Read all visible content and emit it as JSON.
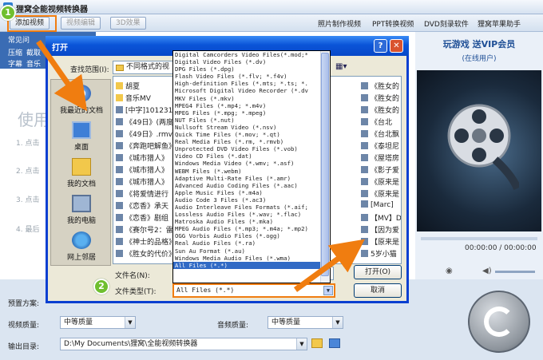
{
  "app": {
    "title": "狸窝全能视频转换器",
    "toolbar": {
      "add_video": "添加视频",
      "video_edit": "视频编辑",
      "effect_3d": "3D效果",
      "links": [
        "照片制作视频",
        "PPT转换视频",
        "DVD刻录软件",
        "狸窝苹果助手"
      ]
    },
    "left_tabs": [
      "常见问",
      "压缩",
      "截取",
      "字幕",
      "音乐"
    ],
    "guide": {
      "heading": "使用",
      "steps": [
        "1. 点击",
        "2. 点击",
        "3. 点击",
        "4. 最后"
      ]
    },
    "promo": {
      "title": "玩游戏 送VIP会员",
      "subtitle": "(在线用户)"
    },
    "player": {
      "time": "00:00:00 / 00:00:00"
    },
    "settings": {
      "preset_label": "预置方案:",
      "video_quality_label": "视频质量:",
      "video_quality_value": "中等质量",
      "audio_quality_label": "音频质量:",
      "audio_quality_value": "中等质量",
      "output_label": "输出目录:",
      "output_value": "D:\\My Documents\\狸窝\\全能视频转换器"
    }
  },
  "dialog": {
    "title": "打开",
    "look_in_label": "查找范围(I):",
    "look_in_value": "不同格式的视",
    "places": [
      "我最近的文档",
      "桌面",
      "我的文档",
      "我的电脑",
      "网上邻居"
    ],
    "files_left": [
      "胡夏",
      "音乐MV",
      "[中字]1012317",
      "《49日》(两度",
      "《49日》.rmvb",
      "《奔跑吧解鱼》",
      "《城市猎人》",
      "《城市猎人》",
      "《城市猎人》",
      "《将爱情进行",
      "《恋香》承天",
      "《恋香》剧组",
      "《赛尔号2：雷",
      "《神士的品格》",
      "《胜女的代价》"
    ],
    "files_right": [
      "《胜女的",
      "《胜女的",
      "《胜女的",
      "《台北",
      "《台北飘",
      "《泰坦尼",
      "《屋塔房",
      "《影子爱",
      "《原来是",
      "《原来是",
      "[Marc]",
      "【MV】D",
      "【因为爱",
      "【原来是",
      "5岁小猫"
    ],
    "filename_label": "文件名(N):",
    "filetype_label": "文件类型(T):",
    "filetype_value": "All Files (*.*)",
    "open_button": "打开(O)",
    "cancel_button": "取消",
    "dropdown_options": [
      "Digital Camcorders Video Files(*.mod;*",
      "Digital Video Files (*.dv)",
      "DPG Files (*.dpg)",
      "Flash Video Files (*.flv; *.f4v)",
      "High-definition Files (*.mts; *.ts; *.",
      "Microsoft Digital Video Recorder (*.dv",
      "MKV Files (*.mkv)",
      "MPEG4 Files (*.mp4; *.m4v)",
      "MPEG Files (*.mpg; *.mpeg)",
      "NUT Files (*.nut)",
      "Nullsoft Stream Video (*.nsv)",
      "Quick Time Files (*.mov; *.qt)",
      "Real Media Files (*.rm, *.rmvb)",
      "Unprotected DVD Video Files (*.vob)",
      "Video CD Files (*.dat)",
      "Windows Media Video (*.wmv; *.asf)",
      "WEBM Files (*.webm)",
      "Adaptive Multi-Rate Files (*.amr)",
      "Advanced Audio Coding Files (*.aac)",
      "Apple Music Files (*.m4a)",
      "Audio Code 3 Files (*.ac3)",
      "Audio Interleave Files Formats (*.aif;",
      "Lossless Audio Files (*.wav; *.flac)",
      "Matroska Audio Files (*.mka)",
      "MPEG Audio Files (*.mp3; *.m4a; *.mp2)",
      "OGG Vorbis Audio Files (*.ogg)",
      "Real Audio Files (*.ra)",
      "Sun Au Format (*.au)",
      "Windows Media Audio Files (*.wma)",
      "All Files (*.*)"
    ],
    "selected_index": 29
  },
  "badges": [
    "1",
    "2"
  ],
  "colors": {
    "highlight": "#f07d10",
    "xp_title": "#0a54d8",
    "badge": "#6fbf2f",
    "selection": "#316ac5"
  }
}
